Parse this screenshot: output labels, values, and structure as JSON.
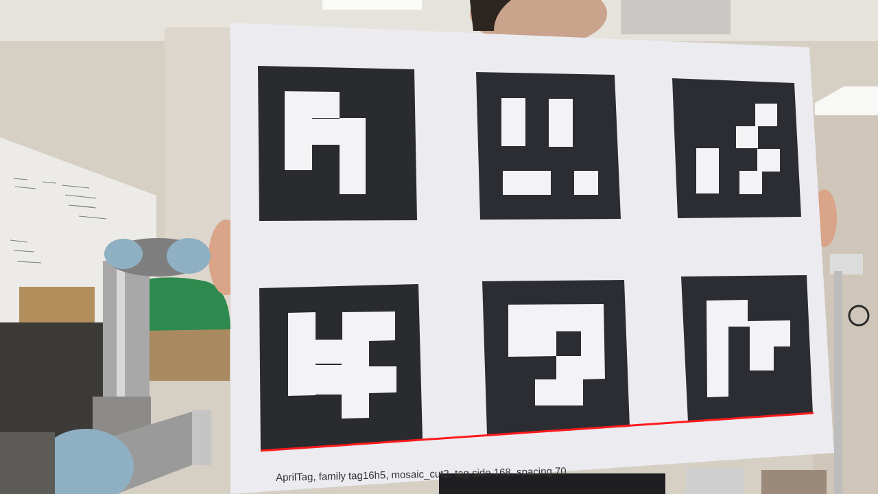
{
  "board": {
    "caption": "AprilTag, family tag16h5, mosaic_cut2, tag side 168, spacing 70"
  },
  "colors": {
    "wall": "#d9d2c8",
    "ceiling": "#e9e5df",
    "board": "#eeeef2",
    "tag_black": "#2a2b2f",
    "tag_white": "#f2f2f5",
    "overlay_line": "#ff1a1a",
    "robot_metal": "#9a9a9a",
    "robot_cap": "#8fb0c2"
  }
}
